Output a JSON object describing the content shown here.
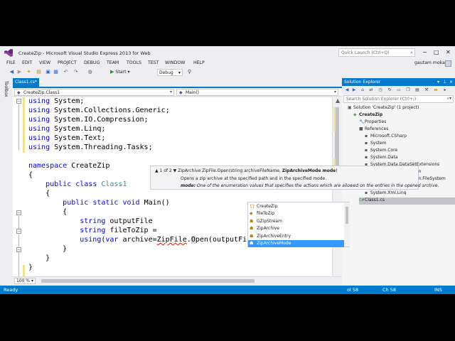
{
  "window": {
    "title": "CreateZip - Microsoft Visual Studio Express 2013 for Web",
    "quick_launch_placeholder": "Quick Launch (Ctrl+Q)",
    "controls": {
      "minimize": "−",
      "maximize": "□",
      "close": "✕"
    }
  },
  "menu": {
    "items": [
      "FILE",
      "EDIT",
      "VIEW",
      "PROJECT",
      "DEBUG",
      "TEAM",
      "TOOLS",
      "TEST",
      "WINDOW",
      "HELP"
    ],
    "user": "gautam mokal"
  },
  "toolbar": {
    "start_label": "Start",
    "config_value": "Debug"
  },
  "toolbox": {
    "label": "Toolbox"
  },
  "document_tab": {
    "label": "Class1.cs*",
    "close": "✕"
  },
  "nav": {
    "class_value": "CreateZip.Class1",
    "member_value": "Main()"
  },
  "editor": {
    "lines": [
      {
        "parts": [
          [
            "kw",
            "using"
          ],
          [
            "",
            "System;"
          ]
        ]
      },
      {
        "parts": [
          [
            "kw",
            "using"
          ],
          [
            "",
            "System.Collections.Generic;"
          ]
        ]
      },
      {
        "parts": [
          [
            "kw",
            "using"
          ],
          [
            "",
            "System.IO.Compression;"
          ]
        ]
      },
      {
        "parts": [
          [
            "kw",
            "using"
          ],
          [
            "",
            "System.Linq;"
          ]
        ]
      },
      {
        "parts": [
          [
            "kw",
            "using"
          ],
          [
            "",
            "System.Text;"
          ]
        ]
      },
      {
        "parts": [
          [
            "kw",
            "using"
          ],
          [
            "",
            "System.Threading.Tasks;"
          ]
        ]
      },
      {
        "parts": []
      },
      {
        "parts": [
          [
            "kw",
            "namespace"
          ],
          [
            "",
            " CreateZip"
          ]
        ]
      },
      {
        "parts": [
          [
            "",
            "{"
          ]
        ]
      },
      {
        "parts": [
          [
            "",
            "    "
          ],
          [
            "kw",
            "public class"
          ],
          [
            "",
            " "
          ],
          [
            "ty",
            "Class1"
          ]
        ]
      },
      {
        "parts": [
          [
            "",
            "    {"
          ]
        ]
      },
      {
        "parts": [
          [
            "",
            "        "
          ],
          [
            "kw",
            "public static void"
          ],
          [
            "",
            " Main()"
          ]
        ]
      },
      {
        "parts": [
          [
            "",
            "        {"
          ]
        ]
      },
      {
        "parts": [
          [
            "",
            "            "
          ],
          [
            "kw",
            "string"
          ],
          [
            "",
            " outputFile"
          ]
        ]
      },
      {
        "parts": [
          [
            "",
            "            "
          ],
          [
            "kw",
            "string"
          ],
          [
            "",
            " fileToZip ="
          ]
        ]
      },
      {
        "parts": [
          [
            "",
            "            "
          ],
          [
            "kw",
            "using"
          ],
          [
            "",
            "("
          ],
          [
            "kw",
            "var"
          ],
          [
            "",
            " archive="
          ],
          [
            "err",
            "ZipFile"
          ],
          [
            "",
            "."
          ],
          [
            "hl",
            "O"
          ],
          [
            "",
            "pen(outputFile,Zip)"
          ],
          [
            "hl",
            ")"
          ]
        ]
      },
      {
        "parts": [
          [
            "",
            "        }"
          ]
        ]
      },
      {
        "parts": [
          [
            "",
            "    }"
          ]
        ]
      },
      {
        "parts": [
          [
            "",
            "}"
          ]
        ]
      }
    ],
    "zoom": "100 %"
  },
  "tooltip": {
    "counter": "▲ 1 of 2 ▼",
    "signature_pre": "ZipArchive ZipFile.Open(string archiveFileName, ",
    "signature_bold": "ZipArchiveMode mode",
    "signature_post": ")",
    "description": "Opens a zip archive at the specified path and in the specified mode.",
    "param_name": "mode:",
    "param_desc": " One of the enumeration values that specifies the actions which are allowed on the entries in the opened archive."
  },
  "completion": {
    "items": [
      {
        "icon": "{}",
        "label": "CreateZip",
        "selected": false
      },
      {
        "icon": "◆",
        "label": "fileToZip",
        "selected": false
      },
      {
        "icon": "☗",
        "label": "GZipStream",
        "selected": false
      },
      {
        "icon": "☗",
        "label": "ZipArchive",
        "selected": false
      },
      {
        "icon": "☗",
        "label": "ZipArchiveEntry",
        "selected": false
      },
      {
        "icon": "☗",
        "label": "ZipArchiveMode",
        "selected": true
      }
    ]
  },
  "solution_explorer": {
    "title": "Solution Explorer",
    "search_placeholder": "Search Solution Explorer (Ctrl+;)",
    "nodes": [
      {
        "label": "Solution 'CreateZip' (1 project)",
        "icon": "▣",
        "indent": 0,
        "bold": false
      },
      {
        "label": "CreateZip",
        "icon": "◈",
        "indent": 1,
        "bold": true
      },
      {
        "label": "Properties",
        "icon": "🔧",
        "indent": 2,
        "bold": false
      },
      {
        "label": "References",
        "icon": "■",
        "indent": 2,
        "bold": false
      },
      {
        "label": "Microsoft.CSharp",
        "icon": "▪",
        "indent": 3,
        "bold": false
      },
      {
        "label": "System",
        "icon": "▪",
        "indent": 3,
        "bold": false
      },
      {
        "label": "System.Core",
        "icon": "▪",
        "indent": 3,
        "bold": false
      },
      {
        "label": "System.Data",
        "icon": "▪",
        "indent": 3,
        "bold": false
      },
      {
        "label": "System.Data.DataSetExtensions",
        "icon": "▪",
        "indent": 3,
        "bold": false
      },
      {
        "label": "System.IO.Compression",
        "icon": "▪",
        "indent": 3,
        "bold": false
      },
      {
        "label": "System.IO.Compression.FileSystem",
        "icon": "▪",
        "indent": 3,
        "bold": false
      },
      {
        "label": "System.Xml",
        "icon": "▪",
        "indent": 3,
        "bold": false
      },
      {
        "label": "System.Xml.Linq",
        "icon": "▪",
        "indent": 3,
        "bold": false
      },
      {
        "label": "Class1.cs",
        "icon": "C#",
        "indent": 2,
        "bold": false
      }
    ]
  },
  "status": {
    "left": "Ready",
    "col": "ol 58",
    "ch": "Ch 58",
    "mode": "INS"
  },
  "colors": {
    "accent": "#007acc",
    "keyword": "#0000ff",
    "type": "#2b91af",
    "error": "#e51400",
    "selection": "#3399ff"
  }
}
